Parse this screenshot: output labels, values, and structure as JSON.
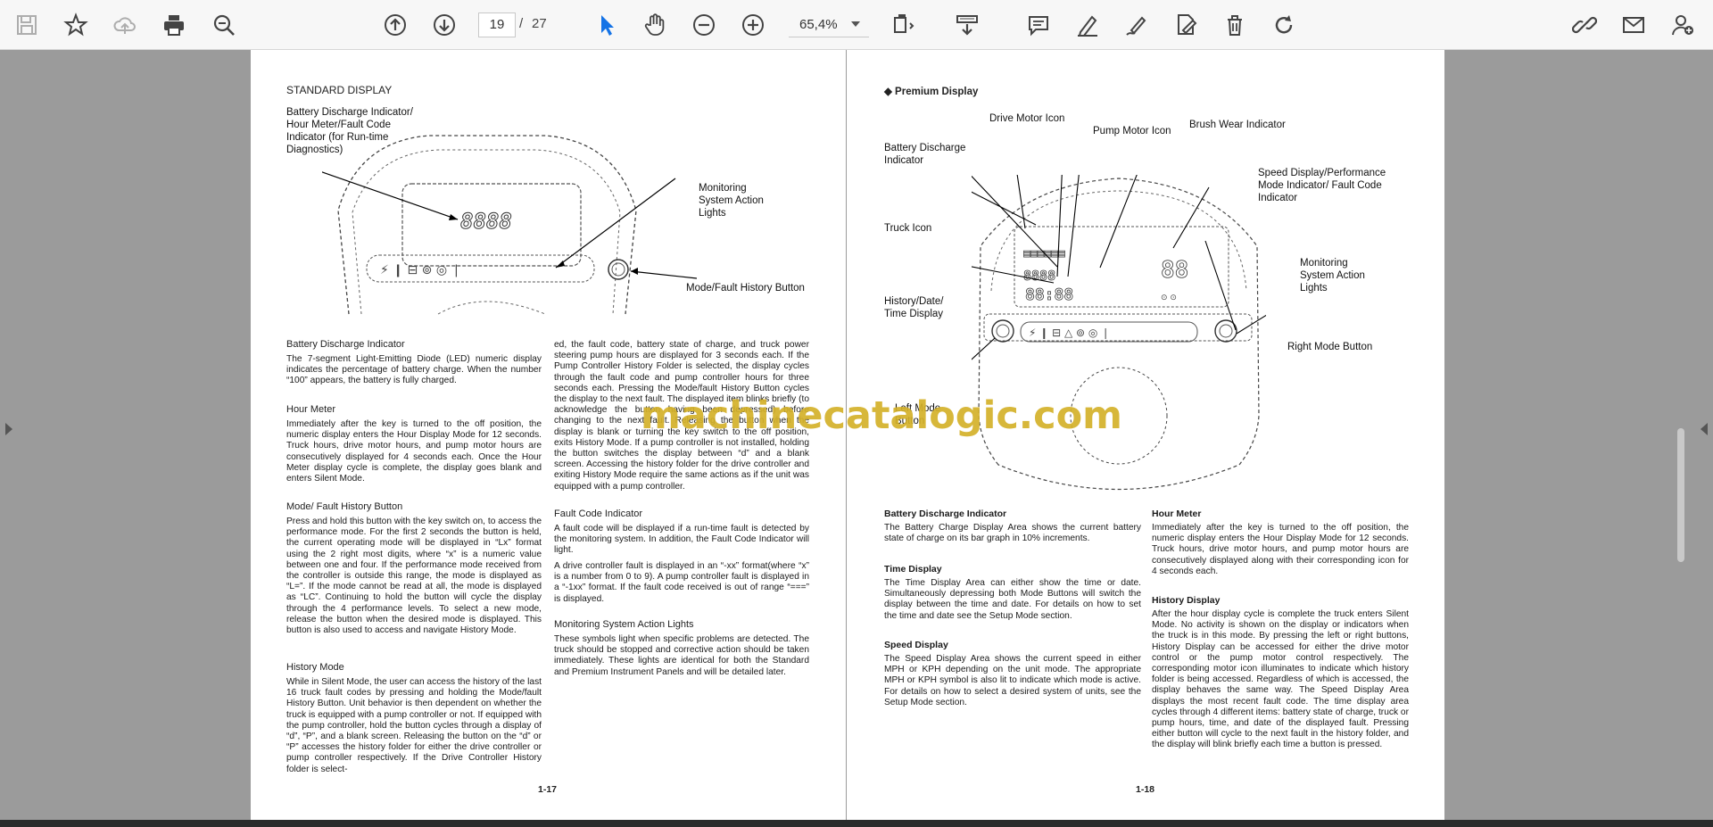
{
  "toolbar": {
    "page_current": "19",
    "page_separator": "/",
    "page_total": "27",
    "zoom": "65,4%",
    "icons": [
      "save-icon",
      "bookmark-star-icon",
      "upload-cloud-icon",
      "print-icon",
      "zoom-search-icon",
      "page-up-icon",
      "page-down-icon",
      "select-cursor-icon",
      "hand-tool-icon",
      "zoom-out-icon",
      "zoom-in-icon",
      "fit-page-icon",
      "scroll-mode-icon",
      "comment-icon",
      "highlight-pen-icon",
      "draw-icon",
      "fill-sign-icon",
      "delete-icon",
      "rotate-icon",
      "share-link-icon",
      "email-icon",
      "user-account-icon"
    ]
  },
  "left_page": {
    "title": "STANDARD DISPLAY",
    "callouts": {
      "battery": "Battery Discharge Indicator/\nHour Meter/Fault Code\nIndicator (for Run-time\nDiagnostics)",
      "monitoring": "Monitoring\nSystem Action\nLights",
      "mode_button": "Mode/Fault History Button"
    },
    "col1": [
      {
        "heading": "Battery Discharge Indicator",
        "body": "The 7-segment Light-Emitting Diode (LED) numeric display indicates the percentage of battery charge. When the number “100” appears, the battery is fully charged."
      },
      {
        "heading": "Hour Meter",
        "body": "Immediately after the key is turned to the off position, the numeric display enters the Hour Display Mode for 12 seconds. Truck hours, drive motor hours, and pump motor hours are consecutively displayed for 4 seconds each. Once the Hour Meter display cycle is complete, the display goes blank and enters Silent Mode."
      },
      {
        "heading": "Mode/ Fault History Button",
        "body": "Press and hold this button with the key switch on, to access the performance mode. For the first 2 seconds the button is held, the current operating mode will be displayed in “Lx” format using the 2 right most digits, where “x” is a numeric value between one and four. If the performance mode received from the controller is outside this range, the mode is displayed as “L=”. If the mode cannot be read at all, the mode is displayed as “LC”. Continuing to hold the button will cycle the display through the 4 performance levels. To select a new mode, release the button when the desired mode is displayed. This button is also used to access and navigate History Mode."
      },
      {
        "heading": "History Mode",
        "body": "While in Silent Mode, the user can access the history of the last 16 truck fault codes by pressing and holding the Mode/fault History Button. Unit behavior is then dependent on whether the truck is equipped with a pump controller or not. If equipped with the pump controller, hold the button cycles through a display of “d”, “P”, and a blank screen. Releasing the button on the “d” or “P” accesses the history folder for either the drive controller or pump controller respectively. If the Drive Controller History folder is select-"
      }
    ],
    "col2_continuation": "ed, the fault code, battery state of charge, and truck power steering pump hours are displayed for 3 seconds each. If the Pump Controller History Folder is selected, the display cycles through the fault code and pump controller hours for three seconds each. Pressing the Mode/fault History Button cycles the display to the next fault. The displayed item blinks briefly (to acknowledge the button having been depressed) before changing to the next fault. Releasing the button when the display is blank or turning the key switch to the off position, exits History Mode. If a pump controller is not installed, holding the button switches the display between “d” and a blank screen. Accessing the history folder for the drive controller and exiting History Mode require the same actions as if the unit was equipped with a pump controller.",
    "col2": [
      {
        "heading": "Fault Code Indicator",
        "body": "A fault code will be displayed if a run-time fault is detected by the monitoring system. In addition, the Fault Code Indicator will light.",
        "body2": "A drive controller fault is displayed in an “-xx” format(where “x” is a number from 0 to 9). A pump controller fault is displayed in a “-1xx” format. If the fault code received is out of range “===” is displayed."
      },
      {
        "heading": "Monitoring System Action Lights",
        "body": "These symbols light when specific problems are detected. The truck should be stopped and corrective action should be taken immediately. These lights are identical for both the Standard and Premium Instrument Panels and will be detailed later."
      }
    ],
    "page_number": "1-17"
  },
  "right_page": {
    "title": "Premium Display",
    "callouts": {
      "drive_motor": "Drive Motor Icon",
      "pump_motor": "Pump Motor Icon",
      "brush_wear": "Brush Wear Indicator",
      "battery": "Battery Discharge\nIndicator",
      "speed": "Speed Display/Performance\nMode Indicator/ Fault Code\nIndicator",
      "truck": "Truck Icon",
      "monitoring": "Monitoring\nSystem Action\nLights",
      "history": "History/Date/\nTime Display",
      "right_mode": "Right Mode Button",
      "left_mode": "Left Mode\nButton"
    },
    "col1": [
      {
        "heading": "Battery Discharge Indicator",
        "body": "The Battery Charge Display Area shows the current battery state of charge on its bar graph in 10% increments."
      },
      {
        "heading": "Time Display",
        "body": "The Time Display Area can either show the time or date. Simultaneously depressing both Mode Buttons will switch the display between the time and date. For details on how to set the time and date see the Setup Mode section."
      },
      {
        "heading": "Speed Display",
        "body": "The Speed Display Area shows the current speed in either MPH or KPH depending on the unit mode. The appropriate MPH or KPH symbol is also lit to indicate which mode is active. For details on how to select a desired system of units, see the Setup Mode section."
      }
    ],
    "col2": [
      {
        "heading": "Hour Meter",
        "body": "Immediately after the key is turned to the off position, the numeric display enters the Hour Display Mode for 12 seconds. Truck hours, drive motor hours, and pump motor hours are consecutively displayed along with their corresponding icon for 4 seconds each."
      },
      {
        "heading": "History Display",
        "body": "After the hour display cycle is complete the truck enters Silent Mode. No activity is shown on the display or indicators when the truck is in this mode. By pressing the left or right buttons, History Display can be accessed for either the drive motor control or the pump motor control respectively. The corresponding motor icon illuminates to indicate which history folder is being accessed. Regardless of which is accessed, the display behaves the same way. The Speed Display Area displays the most recent fault code. The time display area cycles through 4 different items: battery state of charge, truck or pump hours, time, and date of the displayed fault. Pressing either button will cycle to the next fault in the history folder, and the display will blink briefly each time a button is pressed."
      }
    ],
    "page_number": "1-18"
  },
  "watermark": "machinecatalogic.com"
}
